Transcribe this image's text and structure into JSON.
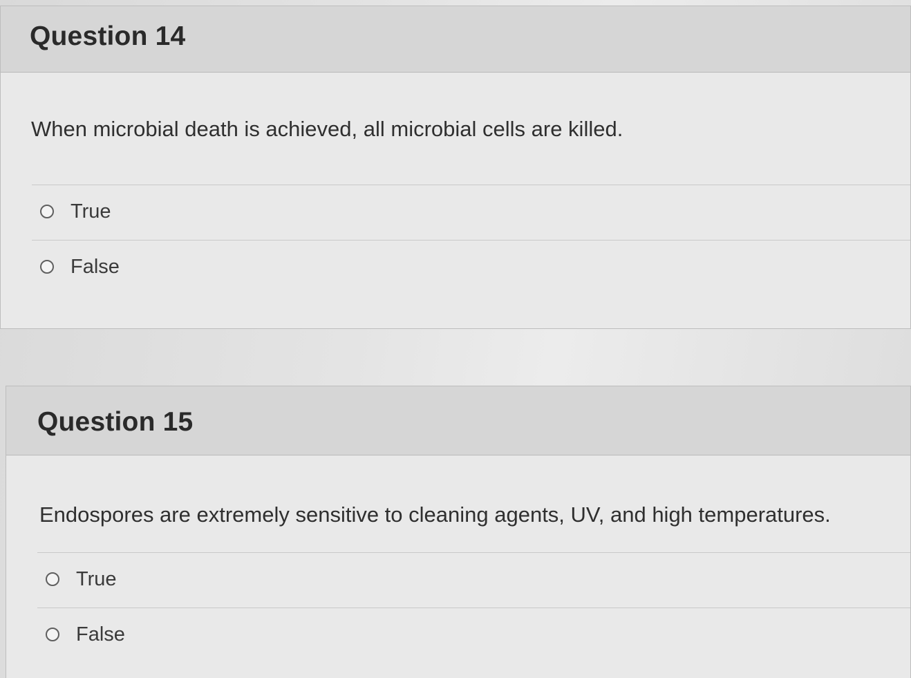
{
  "questions": [
    {
      "title": "Question 14",
      "text": "When microbial death is achieved, all microbial cells are killed.",
      "options": [
        "True",
        "False"
      ]
    },
    {
      "title": "Question 15",
      "text": "Endospores are extremely sensitive to cleaning agents, UV, and high temperatures.",
      "options": [
        "True",
        "False"
      ]
    }
  ],
  "colors": {
    "header_bg": "#d6d6d6",
    "body_bg": "#e9e9e9",
    "text": "#2d2d2d"
  }
}
